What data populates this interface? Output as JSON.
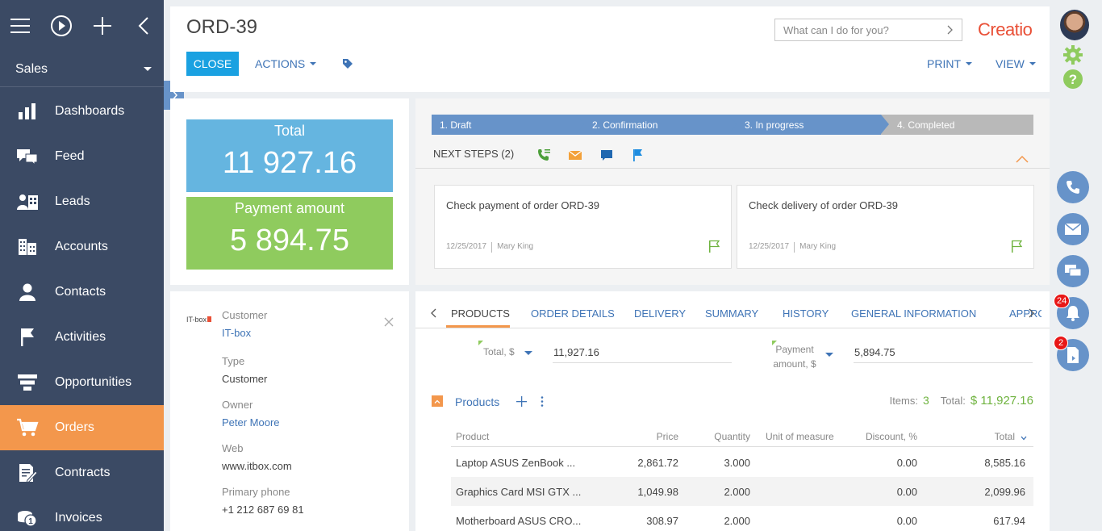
{
  "nav": {
    "workspace": "Sales",
    "items": [
      {
        "label": "Dashboards",
        "icon": "dashboards-icon"
      },
      {
        "label": "Feed",
        "icon": "feed-icon"
      },
      {
        "label": "Leads",
        "icon": "leads-icon"
      },
      {
        "label": "Accounts",
        "icon": "accounts-icon"
      },
      {
        "label": "Contacts",
        "icon": "contacts-icon"
      },
      {
        "label": "Activities",
        "icon": "activities-icon"
      },
      {
        "label": "Opportunities",
        "icon": "opportunities-icon"
      },
      {
        "label": "Orders",
        "icon": "orders-icon",
        "active": true
      },
      {
        "label": "Contracts",
        "icon": "contracts-icon"
      },
      {
        "label": "Invoices",
        "icon": "invoices-icon"
      }
    ]
  },
  "header": {
    "title": "ORD-39",
    "close_label": "CLOSE",
    "actions_label": "ACTIONS",
    "print_label": "PRINT",
    "view_label": "VIEW",
    "search_placeholder": "What can I do for you?",
    "logo": "Creatio"
  },
  "totals": {
    "total_label": "Total",
    "total_value": "11 927.16",
    "payment_label": "Payment amount",
    "payment_value": "5 894.75",
    "total_color": "#65b5e0",
    "payment_color": "#8fcb5e"
  },
  "stages": [
    "1. Draft",
    "2. Confirmation",
    "3. In progress",
    "4. Completed"
  ],
  "next_steps": {
    "label": "NEXT STEPS (2)",
    "tasks": [
      {
        "title": "Check payment of order ORD-39",
        "date": "12/25/2017",
        "owner": "Mary King"
      },
      {
        "title": "Check delivery of order ORD-39",
        "date": "12/25/2017",
        "owner": "Mary King"
      }
    ]
  },
  "account": {
    "logo_text": "IT-box",
    "fields": [
      {
        "label": "Customer",
        "value": "IT-box",
        "link": true
      },
      {
        "label": "Type",
        "value": "Customer",
        "link": false
      },
      {
        "label": "Owner",
        "value": "Peter Moore",
        "link": true
      },
      {
        "label": "Web",
        "value": "www.itbox.com",
        "link": false
      },
      {
        "label": "Primary phone",
        "value": "+1 212 687 69 81",
        "link": false
      }
    ]
  },
  "tabs": [
    "PRODUCTS",
    "ORDER DETAILS",
    "DELIVERY",
    "SUMMARY",
    "HISTORY",
    "GENERAL INFORMATION",
    "APPRO"
  ],
  "products": {
    "total_label": "Total, $",
    "total_value": "11,927.16",
    "payment_label_1": "Payment",
    "payment_label_2": "amount, $",
    "payment_value": "5,894.75",
    "section_label": "Products",
    "items_label": "Items:",
    "items_count": "3",
    "total_sum_label": "Total:",
    "total_sum_value": "$ 11,927.16",
    "columns": [
      "Product",
      "Price",
      "Quantity",
      "Unit of measure",
      "Discount, %",
      "Total"
    ],
    "rows": [
      [
        "Laptop ASUS ZenBook ...",
        "2,861.72",
        "3.000",
        "",
        "0.00",
        "8,585.16"
      ],
      [
        "Graphics Card MSI GTX ...",
        "1,049.98",
        "2.000",
        "",
        "0.00",
        "2,099.96"
      ],
      [
        "Motherboard ASUS CRO...",
        "308.97",
        "2.000",
        "",
        "0.00",
        "617.94"
      ]
    ]
  },
  "rightbar": {
    "notifications_badge": "24",
    "tasks_badge": "2"
  }
}
